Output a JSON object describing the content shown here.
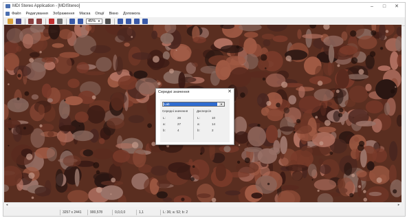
{
  "window": {
    "title": "MDI Stereo Application - [MDIStereo]",
    "controls": [
      "–",
      "□",
      "✕"
    ]
  },
  "menu": [
    "Файл",
    "Редагування",
    "Зображення",
    "Маска",
    "Опції",
    "Вікно",
    "Допомога"
  ],
  "toolbar": {
    "zoom": "45%",
    "buttons": [
      {
        "icon": "open-folder-icon",
        "color": "#d9a23a"
      },
      {
        "icon": "save-icon",
        "color": "#4a4a8a"
      },
      {
        "icon": "copy-icon",
        "color": "#8a4040"
      },
      {
        "icon": "stereo-icon",
        "color": "#8a4040"
      },
      {
        "icon": "record-icon",
        "color": "#c03030"
      },
      {
        "icon": "levels-icon",
        "color": "#707070"
      },
      {
        "icon": "chart-icon",
        "color": "#3a5aa8"
      },
      {
        "icon": "layers-icon",
        "color": "#3a5aa8"
      },
      {
        "icon": "zoom-icon",
        "color": "#505050"
      },
      {
        "icon": "fit-icon",
        "color": "#3a5aa8"
      },
      {
        "icon": "image-icon",
        "color": "#3a5aa8"
      },
      {
        "icon": "grid-icon",
        "color": "#3a5aa8"
      },
      {
        "icon": "table-icon",
        "color": "#3a5aa8"
      }
    ]
  },
  "status": {
    "image_size": "3257 x 2441",
    "cursor": "900,578",
    "offset": "0,0,0,0",
    "scale": "1,1",
    "lab_value": "L: 36; a: 52; b: 2"
  },
  "dialog": {
    "title": "Середні значення",
    "close": "✕",
    "color_space": "Lab",
    "mean": {
      "header": "Середні значення",
      "rows": [
        {
          "label": "L:",
          "value": "28"
        },
        {
          "label": "a:",
          "value": "27"
        },
        {
          "label": "b:",
          "value": "4"
        }
      ]
    },
    "variance": {
      "header": "Дисперсія",
      "rows": [
        {
          "label": "L:",
          "value": "10"
        },
        {
          "label": "a:",
          "value": "14"
        },
        {
          "label": "b:",
          "value": "2"
        }
      ]
    }
  },
  "colors": {
    "image_base": "#5a2e20",
    "select_highlight": "#2f6cd0"
  }
}
